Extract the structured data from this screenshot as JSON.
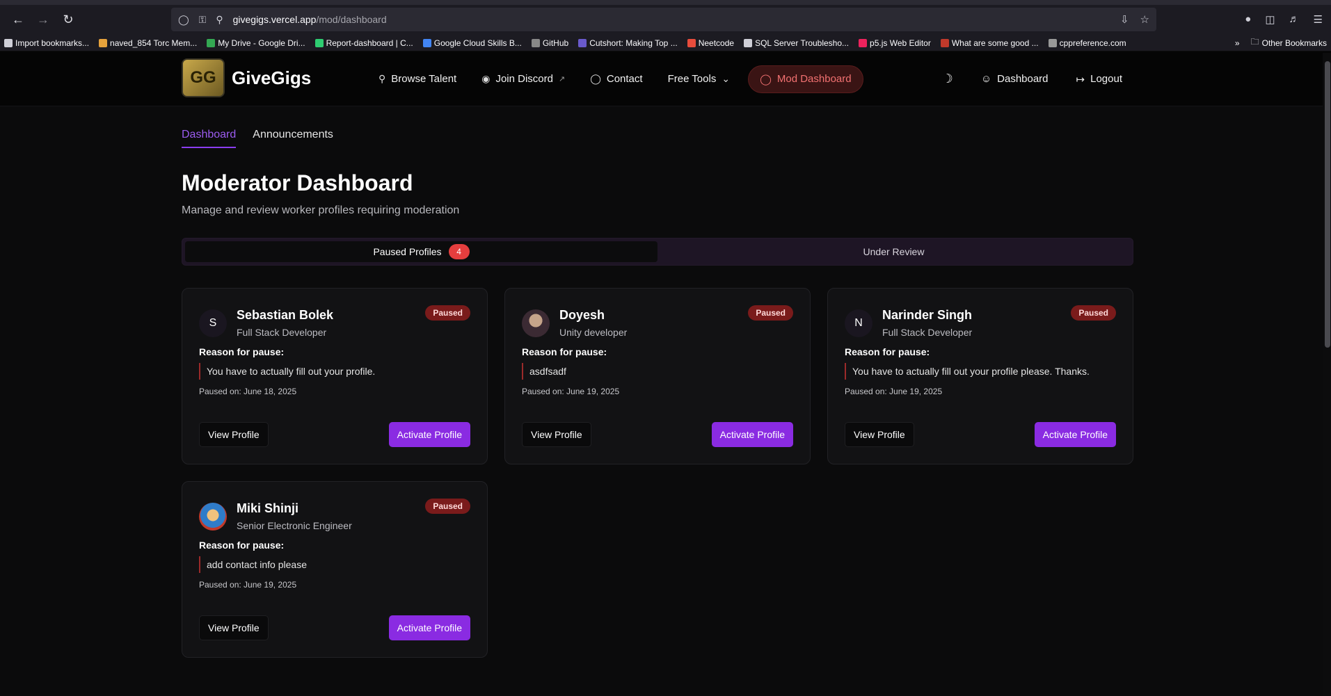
{
  "browser": {
    "url_host": "givegigs.vercel.app",
    "url_path": "/mod/dashboard",
    "bookmarks": [
      {
        "label": "Import bookmarks...",
        "color": "#cfcfd8"
      },
      {
        "label": "naved_854 Torc Mem...",
        "color": "#e6a23c"
      },
      {
        "label": "My Drive - Google Dri...",
        "color": "#34a853"
      },
      {
        "label": "Report-dashboard | C...",
        "color": "#2ecc71"
      },
      {
        "label": "Google Cloud Skills B...",
        "color": "#4285f4"
      },
      {
        "label": "GitHub",
        "color": "#888888"
      },
      {
        "label": "Cutshort: Making Top ...",
        "color": "#6a5acd"
      },
      {
        "label": "Neetcode",
        "color": "#e74c3c"
      },
      {
        "label": "SQL Server Troublesho...",
        "color": "#cfcfd8"
      },
      {
        "label": "p5.js Web Editor",
        "color": "#ed225d"
      },
      {
        "label": "What are some good ...",
        "color": "#c0392b"
      },
      {
        "label": "cppreference.com",
        "color": "#999999"
      }
    ],
    "other_bookmarks": "Other Bookmarks"
  },
  "header": {
    "logo_text": "GiveGigs",
    "logo_mark": "GG",
    "nav": {
      "browse": "Browse Talent",
      "discord": "Join Discord",
      "contact": "Contact",
      "tools": "Free Tools",
      "mod": "Mod Dashboard"
    },
    "dashboard": "Dashboard",
    "logout": "Logout"
  },
  "tabs": {
    "dashboard": "Dashboard",
    "announcements": "Announcements"
  },
  "page": {
    "title": "Moderator Dashboard",
    "subtitle": "Manage and review worker profiles requiring moderation"
  },
  "segment": {
    "paused_label": "Paused Profiles",
    "paused_count": "4",
    "review_label": "Under Review"
  },
  "labels": {
    "reason": "Reason for pause:",
    "view": "View Profile",
    "activate": "Activate Profile",
    "status": "Paused"
  },
  "cards": [
    {
      "initial": "S",
      "name": "Sebastian Bolek",
      "role": "Full Stack Developer",
      "reason": "You have to actually fill out your profile.",
      "paused_on": "Paused on: June 18, 2025"
    },
    {
      "initial": "",
      "name": "Doyesh",
      "role": "Unity developer",
      "reason": "asdfsadf",
      "paused_on": "Paused on: June 19, 2025"
    },
    {
      "initial": "N",
      "name": "Narinder Singh",
      "role": "Full Stack Developer",
      "reason": "You have to actually fill out your profile please. Thanks.",
      "paused_on": "Paused on: June 19, 2025"
    },
    {
      "initial": "",
      "name": "Miki Shinji",
      "role": "Senior Electronic Engineer",
      "reason": "add contact info please",
      "paused_on": "Paused on: June 19, 2025"
    }
  ]
}
